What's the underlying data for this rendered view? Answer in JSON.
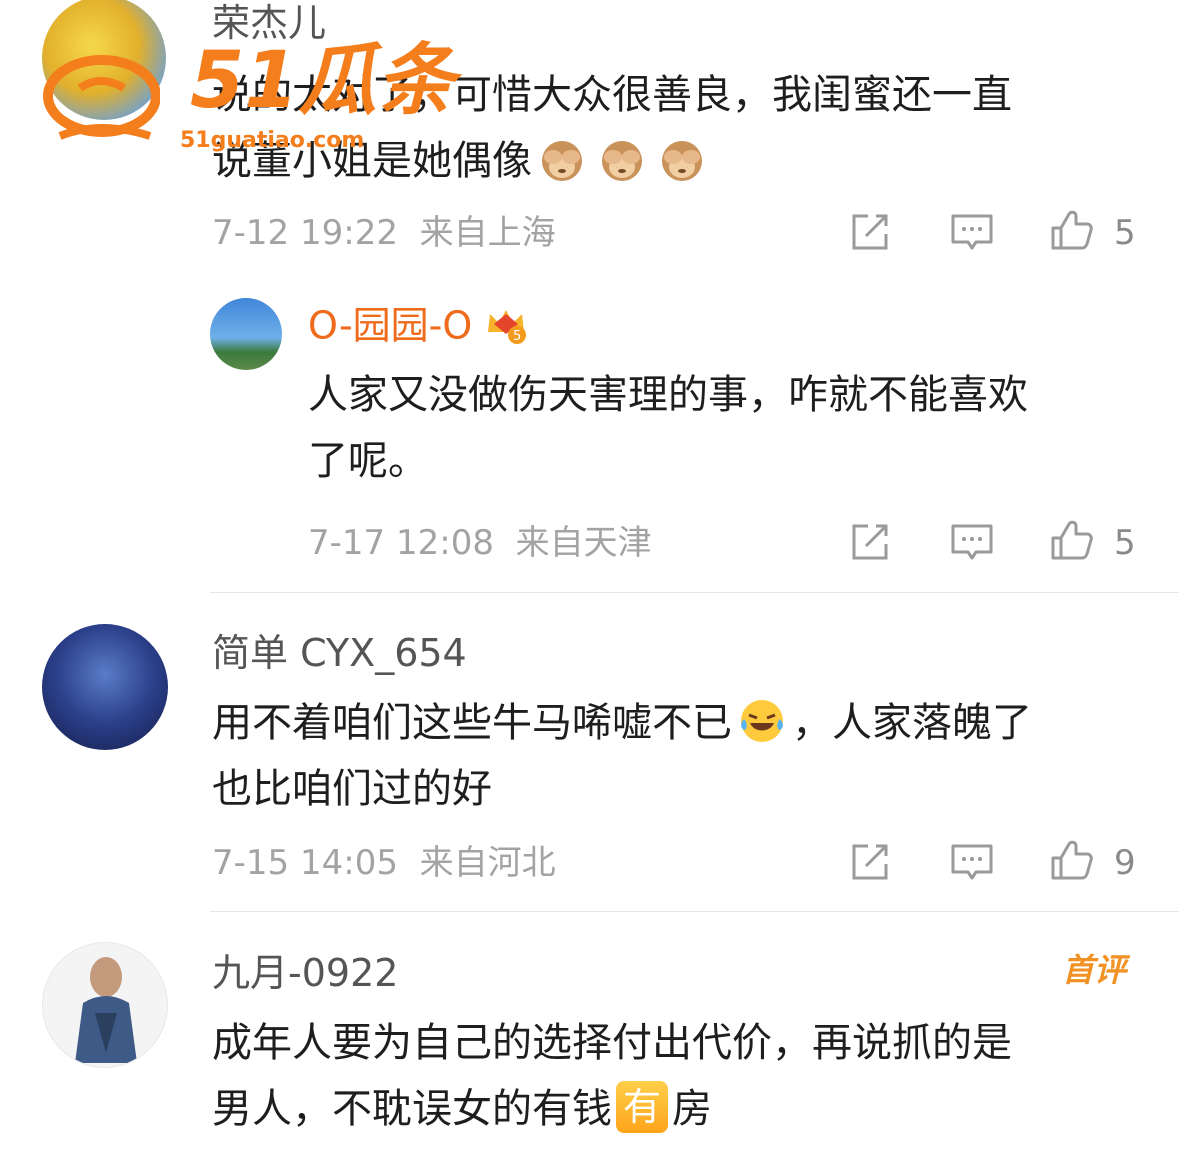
{
  "comments": [
    {
      "user": "荣杰儿",
      "line1": "说的太对了，可惜大众很善良，我闺蜜还一直",
      "line2": "说董小姐是她偶像",
      "time": "7-12 19:22",
      "location": "来自上海",
      "likes": "5"
    },
    {
      "user": "O-园园-O",
      "line1": "人家又没做伤天害理的事，咋就不能喜欢",
      "line2": "了呢。",
      "time": "7-17 12:08",
      "location": "来自天津",
      "likes": "5"
    },
    {
      "user": "简单 CYX_654",
      "line1a": "用不着咱们这些牛马唏嘘不已",
      "line1b": "，人家落魄了",
      "line2": "也比咱们过的好",
      "time": "7-15 14:05",
      "location": "来自河北",
      "likes": "9"
    },
    {
      "user": "九月-0922",
      "tag": "首评",
      "line1": "成年人要为自己的选择付出代价，再说抓的是",
      "line2a": "男人，不耽误女的有钱",
      "badge": "有",
      "line2b": "房"
    }
  ],
  "watermark": {
    "brand": "51瓜条",
    "site": "51guatiao.com"
  },
  "icons": {
    "share": "share-icon",
    "comment": "comment-icon",
    "like": "thumbs-up-icon",
    "emoji_monkey": "see-no-evil-monkey-emoji",
    "emoji_laugh": "tears-of-joy-emoji",
    "vip": "crown-badge-icon"
  },
  "colors": {
    "vip_name": "#f06a1c",
    "first_comment_tag": "#f29224",
    "watermark": "#f47d1c"
  }
}
